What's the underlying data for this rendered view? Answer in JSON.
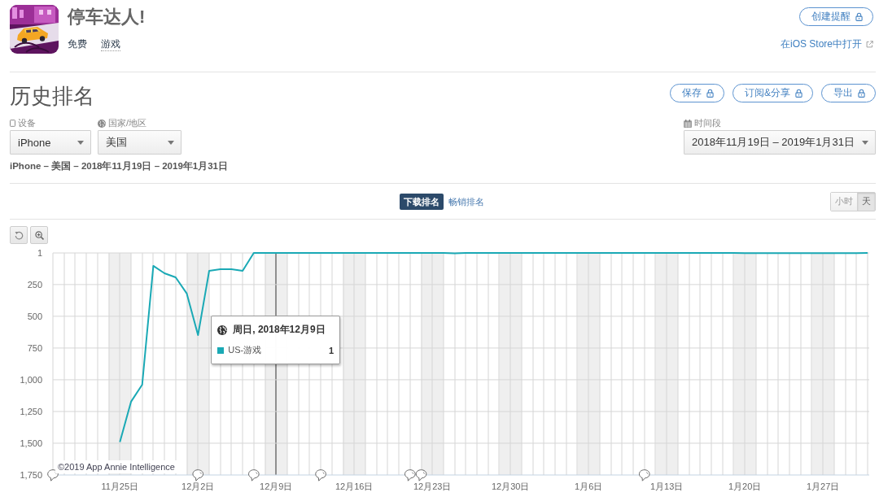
{
  "app": {
    "title": "停车达人!",
    "price": "免费",
    "category": "游戏"
  },
  "header_actions": {
    "alert_button": "创建提醒",
    "store_link": "在iOS Store中打开"
  },
  "section": {
    "title": "历史排名",
    "buttons": [
      "保存",
      "订阅&分享",
      "导出"
    ]
  },
  "filters": [
    {
      "kind": "device",
      "label": "设备",
      "value": "iPhone"
    },
    {
      "kind": "country",
      "label": "国家/地区",
      "value": "美国"
    }
  ],
  "date_range": {
    "label": "时间段",
    "value": "2018年11月19日 – 2019年1月31日"
  },
  "summary": "iPhone – 美国 – 2018年11月19日 – 2019年1月31日",
  "rank_tabs": [
    {
      "label": "下载排名",
      "selected": true
    },
    {
      "label": "畅销排名",
      "selected": false
    }
  ],
  "granularity": [
    {
      "label": "小时",
      "selected": false
    },
    {
      "label": "天",
      "selected": true
    }
  ],
  "chart": {
    "credit": "©2019 App Annie Intelligence",
    "tooltip": {
      "title": "周日, 2018年12月9日",
      "values": [
        "1"
      ]
    },
    "days": [
      {
        "weekend": false,
        "note": true,
        "hovered": false
      },
      {
        "weekend": false,
        "note": false,
        "hovered": false
      },
      {
        "weekend": false,
        "note": false,
        "hovered": false
      },
      {
        "weekend": false,
        "note": false,
        "hovered": false
      },
      {
        "weekend": false,
        "note": false,
        "hovered": false
      },
      {
        "weekend": true,
        "note": false,
        "hovered": false
      },
      {
        "weekend": true,
        "note": false,
        "hovered": false
      },
      {
        "weekend": false,
        "note": false,
        "hovered": false
      },
      {
        "weekend": false,
        "note": false,
        "hovered": false
      },
      {
        "weekend": false,
        "note": false,
        "hovered": false
      },
      {
        "weekend": false,
        "note": false,
        "hovered": false
      },
      {
        "weekend": false,
        "note": false,
        "hovered": false
      },
      {
        "weekend": true,
        "note": false,
        "hovered": false
      },
      {
        "weekend": true,
        "note": true,
        "hovered": false
      },
      {
        "weekend": false,
        "note": false,
        "hovered": false
      },
      {
        "weekend": false,
        "note": false,
        "hovered": false
      },
      {
        "weekend": false,
        "note": false,
        "hovered": false
      },
      {
        "weekend": false,
        "note": false,
        "hovered": false
      },
      {
        "weekend": false,
        "note": true,
        "hovered": false
      },
      {
        "weekend": true,
        "note": false,
        "hovered": false
      },
      {
        "weekend": true,
        "note": false,
        "hovered": true
      },
      {
        "weekend": false,
        "note": false,
        "hovered": false
      },
      {
        "weekend": false,
        "note": false,
        "hovered": false
      },
      {
        "weekend": false,
        "note": false,
        "hovered": false
      },
      {
        "weekend": false,
        "note": true,
        "hovered": false
      },
      {
        "weekend": false,
        "note": false,
        "hovered": false
      },
      {
        "weekend": true,
        "note": false,
        "hovered": false
      },
      {
        "weekend": true,
        "note": false,
        "hovered": false
      },
      {
        "weekend": false,
        "note": false,
        "hovered": false
      },
      {
        "weekend": false,
        "note": false,
        "hovered": false
      },
      {
        "weekend": false,
        "note": false,
        "hovered": false
      },
      {
        "weekend": false,
        "note": false,
        "hovered": false
      },
      {
        "weekend": false,
        "note": true,
        "hovered": false
      },
      {
        "weekend": true,
        "note": true,
        "hovered": false
      },
      {
        "weekend": true,
        "note": false,
        "hovered": false
      },
      {
        "weekend": false,
        "note": false,
        "hovered": false
      },
      {
        "weekend": false,
        "note": false,
        "hovered": false
      },
      {
        "weekend": false,
        "note": false,
        "hovered": false
      },
      {
        "weekend": false,
        "note": false,
        "hovered": false
      },
      {
        "weekend": false,
        "note": false,
        "hovered": false
      },
      {
        "weekend": true,
        "note": false,
        "hovered": false
      },
      {
        "weekend": true,
        "note": false,
        "hovered": false
      },
      {
        "weekend": false,
        "note": false,
        "hovered": false
      },
      {
        "weekend": false,
        "note": false,
        "hovered": false
      },
      {
        "weekend": false,
        "note": false,
        "hovered": false
      },
      {
        "weekend": false,
        "note": false,
        "hovered": false
      },
      {
        "weekend": false,
        "note": false,
        "hovered": false
      },
      {
        "weekend": true,
        "note": false,
        "hovered": false
      },
      {
        "weekend": true,
        "note": false,
        "hovered": false
      },
      {
        "weekend": false,
        "note": false,
        "hovered": false
      },
      {
        "weekend": false,
        "note": false,
        "hovered": false
      },
      {
        "weekend": false,
        "note": false,
        "hovered": false
      },
      {
        "weekend": false,
        "note": false,
        "hovered": false
      },
      {
        "weekend": false,
        "note": true,
        "hovered": false
      },
      {
        "weekend": true,
        "note": false,
        "hovered": false
      },
      {
        "weekend": true,
        "note": false,
        "hovered": false
      },
      {
        "weekend": false,
        "note": false,
        "hovered": false
      },
      {
        "weekend": false,
        "note": false,
        "hovered": false
      },
      {
        "weekend": false,
        "note": false,
        "hovered": false
      },
      {
        "weekend": false,
        "note": false,
        "hovered": false
      },
      {
        "weekend": false,
        "note": false,
        "hovered": false
      },
      {
        "weekend": true,
        "note": false,
        "hovered": false
      },
      {
        "weekend": true,
        "note": false,
        "hovered": false
      },
      {
        "weekend": false,
        "note": false,
        "hovered": false
      },
      {
        "weekend": false,
        "note": false,
        "hovered": false
      },
      {
        "weekend": false,
        "note": false,
        "hovered": false
      },
      {
        "weekend": false,
        "note": false,
        "hovered": false
      },
      {
        "weekend": false,
        "note": false,
        "hovered": false
      },
      {
        "weekend": true,
        "note": false,
        "hovered": false
      },
      {
        "weekend": true,
        "note": false,
        "hovered": false
      },
      {
        "weekend": false,
        "note": false,
        "hovered": false
      },
      {
        "weekend": false,
        "note": false,
        "hovered": false
      },
      {
        "weekend": false,
        "note": false,
        "hovered": false
      },
      {
        "weekend": false,
        "note": false,
        "hovered": false
      }
    ],
    "chart_data": {
      "type": "line",
      "grid": true,
      "categories": [
        null,
        null,
        null,
        null,
        null,
        null,
        "11月25日",
        null,
        null,
        null,
        null,
        null,
        null,
        "12月2日",
        null,
        null,
        null,
        null,
        null,
        null,
        "12月9日",
        null,
        null,
        null,
        null,
        null,
        null,
        "12月16日",
        null,
        null,
        null,
        null,
        null,
        null,
        "12月23日",
        null,
        null,
        null,
        null,
        null,
        null,
        "12月30日",
        null,
        null,
        null,
        null,
        null,
        null,
        "1月6日",
        null,
        null,
        null,
        null,
        null,
        null,
        "1月13日",
        null,
        null,
        null,
        null,
        null,
        null,
        "1月20日",
        null,
        null,
        null,
        null,
        null,
        null,
        "1月27日",
        null,
        null,
        null,
        null
      ],
      "series": [
        {
          "name": "US-游戏",
          "color": "#1aa9b5",
          "values": [
            null,
            null,
            null,
            null,
            null,
            null,
            1490,
            1173,
            1039,
            103,
            161,
            193,
            321,
            648,
            142,
            129,
            129,
            142,
            1,
            1,
            1,
            1,
            1,
            1,
            1,
            1,
            1,
            1,
            1,
            1,
            1,
            1,
            1,
            1,
            1,
            1,
            4,
            1,
            1,
            1,
            1,
            1,
            1,
            1,
            1,
            1,
            1,
            1,
            1,
            1,
            1,
            1,
            1,
            1,
            1,
            1,
            1,
            1,
            1,
            1,
            1,
            1,
            3,
            3,
            3,
            3,
            3,
            3,
            3,
            3,
            3,
            3,
            3,
            1
          ]
        }
      ],
      "ylim": [
        1750,
        1
      ],
      "yticks": [
        {
          "value": 1,
          "label": "1"
        },
        {
          "value": 250,
          "label": "250"
        },
        {
          "value": 500,
          "label": "500"
        },
        {
          "value": 750,
          "label": "750"
        },
        {
          "value": 1000,
          "label": "1,000"
        },
        {
          "value": 1250,
          "label": "1,250"
        },
        {
          "value": 1500,
          "label": "1,500"
        },
        {
          "value": 1750,
          "label": "1,750"
        }
      ]
    }
  }
}
